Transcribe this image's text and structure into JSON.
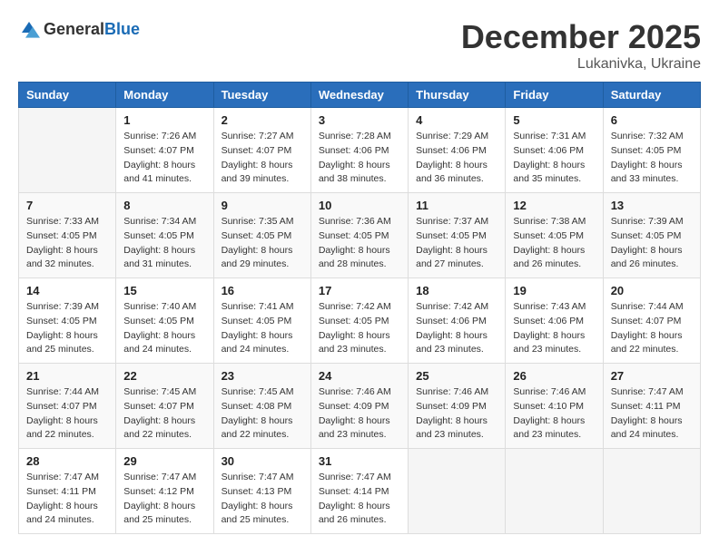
{
  "logo": {
    "general": "General",
    "blue": "Blue"
  },
  "header": {
    "month": "December 2025",
    "location": "Lukanivka, Ukraine"
  },
  "weekdays": [
    "Sunday",
    "Monday",
    "Tuesday",
    "Wednesday",
    "Thursday",
    "Friday",
    "Saturday"
  ],
  "weeks": [
    [
      {
        "day": "",
        "sunrise": "",
        "sunset": "",
        "daylight": ""
      },
      {
        "day": "1",
        "sunrise": "Sunrise: 7:26 AM",
        "sunset": "Sunset: 4:07 PM",
        "daylight": "Daylight: 8 hours and 41 minutes."
      },
      {
        "day": "2",
        "sunrise": "Sunrise: 7:27 AM",
        "sunset": "Sunset: 4:07 PM",
        "daylight": "Daylight: 8 hours and 39 minutes."
      },
      {
        "day": "3",
        "sunrise": "Sunrise: 7:28 AM",
        "sunset": "Sunset: 4:06 PM",
        "daylight": "Daylight: 8 hours and 38 minutes."
      },
      {
        "day": "4",
        "sunrise": "Sunrise: 7:29 AM",
        "sunset": "Sunset: 4:06 PM",
        "daylight": "Daylight: 8 hours and 36 minutes."
      },
      {
        "day": "5",
        "sunrise": "Sunrise: 7:31 AM",
        "sunset": "Sunset: 4:06 PM",
        "daylight": "Daylight: 8 hours and 35 minutes."
      },
      {
        "day": "6",
        "sunrise": "Sunrise: 7:32 AM",
        "sunset": "Sunset: 4:05 PM",
        "daylight": "Daylight: 8 hours and 33 minutes."
      }
    ],
    [
      {
        "day": "7",
        "sunrise": "Sunrise: 7:33 AM",
        "sunset": "Sunset: 4:05 PM",
        "daylight": "Daylight: 8 hours and 32 minutes."
      },
      {
        "day": "8",
        "sunrise": "Sunrise: 7:34 AM",
        "sunset": "Sunset: 4:05 PM",
        "daylight": "Daylight: 8 hours and 31 minutes."
      },
      {
        "day": "9",
        "sunrise": "Sunrise: 7:35 AM",
        "sunset": "Sunset: 4:05 PM",
        "daylight": "Daylight: 8 hours and 29 minutes."
      },
      {
        "day": "10",
        "sunrise": "Sunrise: 7:36 AM",
        "sunset": "Sunset: 4:05 PM",
        "daylight": "Daylight: 8 hours and 28 minutes."
      },
      {
        "day": "11",
        "sunrise": "Sunrise: 7:37 AM",
        "sunset": "Sunset: 4:05 PM",
        "daylight": "Daylight: 8 hours and 27 minutes."
      },
      {
        "day": "12",
        "sunrise": "Sunrise: 7:38 AM",
        "sunset": "Sunset: 4:05 PM",
        "daylight": "Daylight: 8 hours and 26 minutes."
      },
      {
        "day": "13",
        "sunrise": "Sunrise: 7:39 AM",
        "sunset": "Sunset: 4:05 PM",
        "daylight": "Daylight: 8 hours and 26 minutes."
      }
    ],
    [
      {
        "day": "14",
        "sunrise": "Sunrise: 7:39 AM",
        "sunset": "Sunset: 4:05 PM",
        "daylight": "Daylight: 8 hours and 25 minutes."
      },
      {
        "day": "15",
        "sunrise": "Sunrise: 7:40 AM",
        "sunset": "Sunset: 4:05 PM",
        "daylight": "Daylight: 8 hours and 24 minutes."
      },
      {
        "day": "16",
        "sunrise": "Sunrise: 7:41 AM",
        "sunset": "Sunset: 4:05 PM",
        "daylight": "Daylight: 8 hours and 24 minutes."
      },
      {
        "day": "17",
        "sunrise": "Sunrise: 7:42 AM",
        "sunset": "Sunset: 4:05 PM",
        "daylight": "Daylight: 8 hours and 23 minutes."
      },
      {
        "day": "18",
        "sunrise": "Sunrise: 7:42 AM",
        "sunset": "Sunset: 4:06 PM",
        "daylight": "Daylight: 8 hours and 23 minutes."
      },
      {
        "day": "19",
        "sunrise": "Sunrise: 7:43 AM",
        "sunset": "Sunset: 4:06 PM",
        "daylight": "Daylight: 8 hours and 23 minutes."
      },
      {
        "day": "20",
        "sunrise": "Sunrise: 7:44 AM",
        "sunset": "Sunset: 4:07 PM",
        "daylight": "Daylight: 8 hours and 22 minutes."
      }
    ],
    [
      {
        "day": "21",
        "sunrise": "Sunrise: 7:44 AM",
        "sunset": "Sunset: 4:07 PM",
        "daylight": "Daylight: 8 hours and 22 minutes."
      },
      {
        "day": "22",
        "sunrise": "Sunrise: 7:45 AM",
        "sunset": "Sunset: 4:07 PM",
        "daylight": "Daylight: 8 hours and 22 minutes."
      },
      {
        "day": "23",
        "sunrise": "Sunrise: 7:45 AM",
        "sunset": "Sunset: 4:08 PM",
        "daylight": "Daylight: 8 hours and 22 minutes."
      },
      {
        "day": "24",
        "sunrise": "Sunrise: 7:46 AM",
        "sunset": "Sunset: 4:09 PM",
        "daylight": "Daylight: 8 hours and 23 minutes."
      },
      {
        "day": "25",
        "sunrise": "Sunrise: 7:46 AM",
        "sunset": "Sunset: 4:09 PM",
        "daylight": "Daylight: 8 hours and 23 minutes."
      },
      {
        "day": "26",
        "sunrise": "Sunrise: 7:46 AM",
        "sunset": "Sunset: 4:10 PM",
        "daylight": "Daylight: 8 hours and 23 minutes."
      },
      {
        "day": "27",
        "sunrise": "Sunrise: 7:47 AM",
        "sunset": "Sunset: 4:11 PM",
        "daylight": "Daylight: 8 hours and 24 minutes."
      }
    ],
    [
      {
        "day": "28",
        "sunrise": "Sunrise: 7:47 AM",
        "sunset": "Sunset: 4:11 PM",
        "daylight": "Daylight: 8 hours and 24 minutes."
      },
      {
        "day": "29",
        "sunrise": "Sunrise: 7:47 AM",
        "sunset": "Sunset: 4:12 PM",
        "daylight": "Daylight: 8 hours and 25 minutes."
      },
      {
        "day": "30",
        "sunrise": "Sunrise: 7:47 AM",
        "sunset": "Sunset: 4:13 PM",
        "daylight": "Daylight: 8 hours and 25 minutes."
      },
      {
        "day": "31",
        "sunrise": "Sunrise: 7:47 AM",
        "sunset": "Sunset: 4:14 PM",
        "daylight": "Daylight: 8 hours and 26 minutes."
      },
      {
        "day": "",
        "sunrise": "",
        "sunset": "",
        "daylight": ""
      },
      {
        "day": "",
        "sunrise": "",
        "sunset": "",
        "daylight": ""
      },
      {
        "day": "",
        "sunrise": "",
        "sunset": "",
        "daylight": ""
      }
    ]
  ]
}
